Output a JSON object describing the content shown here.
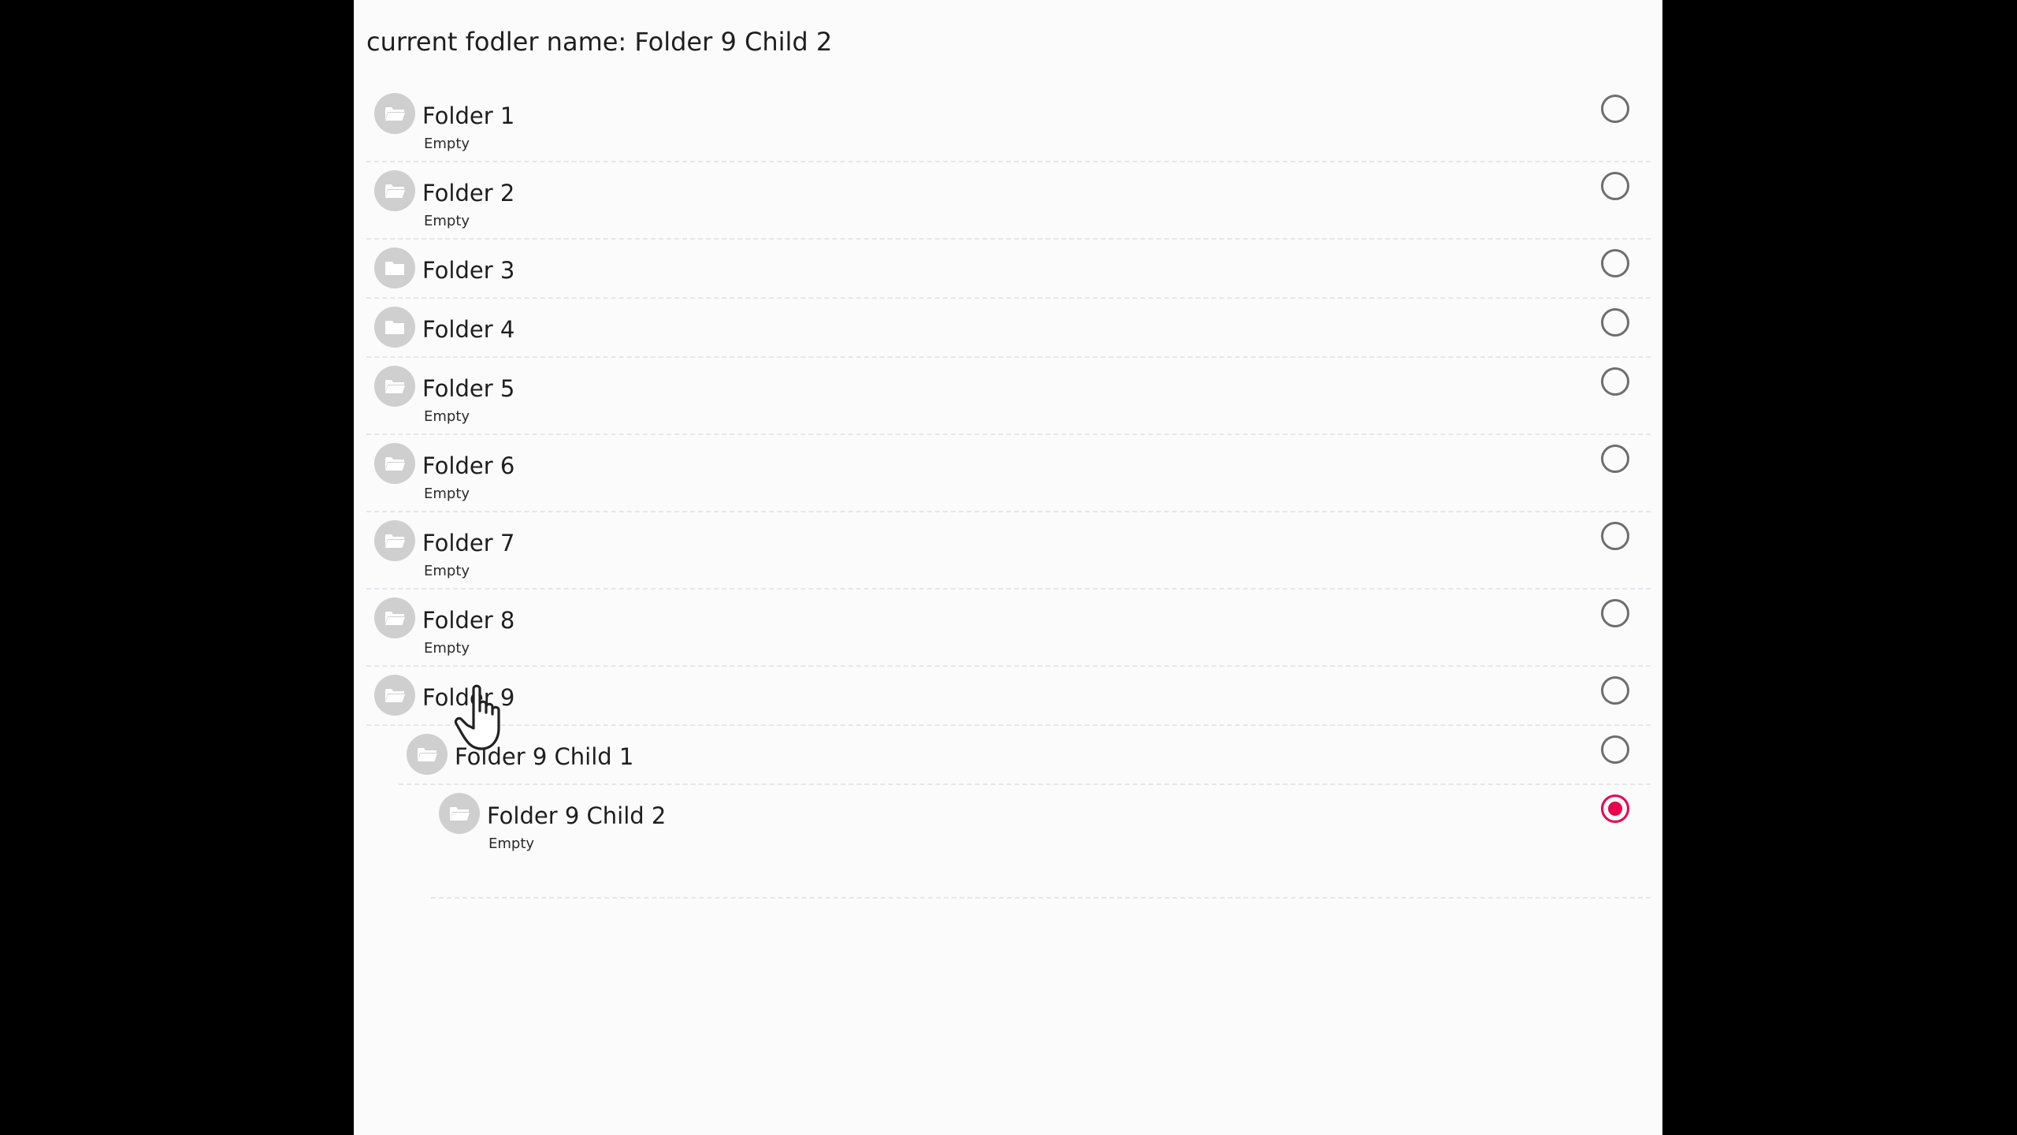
{
  "header": {
    "title": "current fodler name: Folder 9 Child 2"
  },
  "folders": [
    {
      "name": "Folder 1",
      "subtitle": "Empty",
      "icon": "folder-open-icon",
      "depth": 0,
      "selected": false
    },
    {
      "name": "Folder 2",
      "subtitle": "Empty",
      "icon": "folder-open-icon",
      "depth": 0,
      "selected": false
    },
    {
      "name": "Folder 3",
      "subtitle": "",
      "icon": "folder-closed-icon",
      "depth": 0,
      "selected": false
    },
    {
      "name": "Folder 4",
      "subtitle": "",
      "icon": "folder-closed-icon",
      "depth": 0,
      "selected": false
    },
    {
      "name": "Folder 5",
      "subtitle": "Empty",
      "icon": "folder-open-icon",
      "depth": 0,
      "selected": false
    },
    {
      "name": "Folder 6",
      "subtitle": "Empty",
      "icon": "folder-open-icon",
      "depth": 0,
      "selected": false
    },
    {
      "name": "Folder 7",
      "subtitle": "Empty",
      "icon": "folder-open-icon",
      "depth": 0,
      "selected": false
    },
    {
      "name": "Folder 8",
      "subtitle": "Empty",
      "icon": "folder-open-icon",
      "depth": 0,
      "selected": false
    },
    {
      "name": "Folder 9",
      "subtitle": "",
      "icon": "folder-open-icon",
      "depth": 0,
      "selected": false
    },
    {
      "name": "Folder 9 Child 1",
      "subtitle": "",
      "icon": "folder-open-icon",
      "depth": 1,
      "selected": false
    },
    {
      "name": "Folder 9 Child 2",
      "subtitle": "Empty",
      "icon": "folder-open-icon",
      "depth": 2,
      "selected": true
    }
  ],
  "colors": {
    "accent": "#e8004f",
    "radio_border": "#6e6e6e",
    "icon_bg": "#cfcfcf",
    "divider": "#e4e6ea",
    "panel_bg": "#fbfbfb",
    "backdrop": "#000000"
  },
  "cursor": {
    "icon": "hand-pointer-icon"
  }
}
